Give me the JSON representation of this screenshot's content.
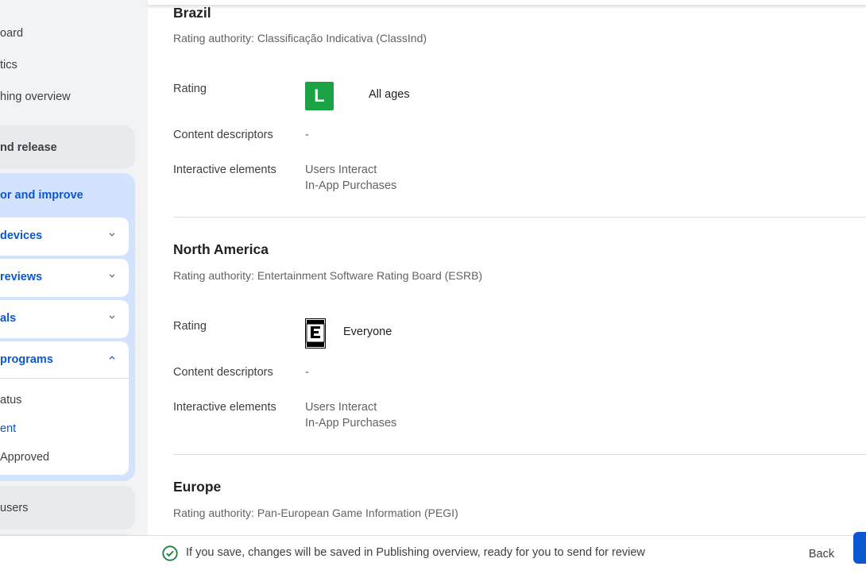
{
  "sidebar": {
    "top_items": [
      "oard",
      "tics",
      "hing overview"
    ],
    "release_label": "nd release",
    "monitor_label": "or and improve",
    "cards": [
      {
        "label": "devices",
        "expanded": false
      },
      {
        "label": " reviews",
        "expanded": false
      },
      {
        "label": "als",
        "expanded": false
      },
      {
        "label": "programs",
        "expanded": true
      }
    ],
    "subitems": [
      {
        "label": "atus",
        "active": false
      },
      {
        "label": "ent",
        "active": true
      },
      {
        "label": "Approved",
        "active": false
      }
    ],
    "users_label": "users"
  },
  "sections": [
    {
      "name": "Brazil",
      "authority": "Rating authority: Classificação Indicativa (ClassInd)",
      "rating_label": "Rating",
      "rating_icon": "classind-L-icon",
      "rating_icon_text": "L",
      "rating_value": "All ages",
      "descriptors_label": "Content descriptors",
      "descriptors_value": "-",
      "interactive_label": "Interactive elements",
      "interactive_values": [
        "Users Interact",
        "In-App Purchases"
      ]
    },
    {
      "name": "North America",
      "authority": "Rating authority: Entertainment Software Rating Board (ESRB)",
      "rating_label": "Rating",
      "rating_icon": "esrb-everyone-icon",
      "rating_value": "Everyone",
      "descriptors_label": "Content descriptors",
      "descriptors_value": "-",
      "interactive_label": "Interactive elements",
      "interactive_values": [
        "Users Interact",
        "In-App Purchases"
      ]
    },
    {
      "name": "Europe",
      "authority": "Rating authority: Pan-European Game Information (PEGI)"
    }
  ],
  "footer": {
    "message": "If you save, changes will be saved in Publishing overview, ready for you to send for review",
    "back_label": "Back"
  },
  "colors": {
    "accent": "#0b57d0",
    "active_group_bg": "#d3e3fd",
    "classind_green": "#1aa245",
    "success_green": "#188038"
  }
}
